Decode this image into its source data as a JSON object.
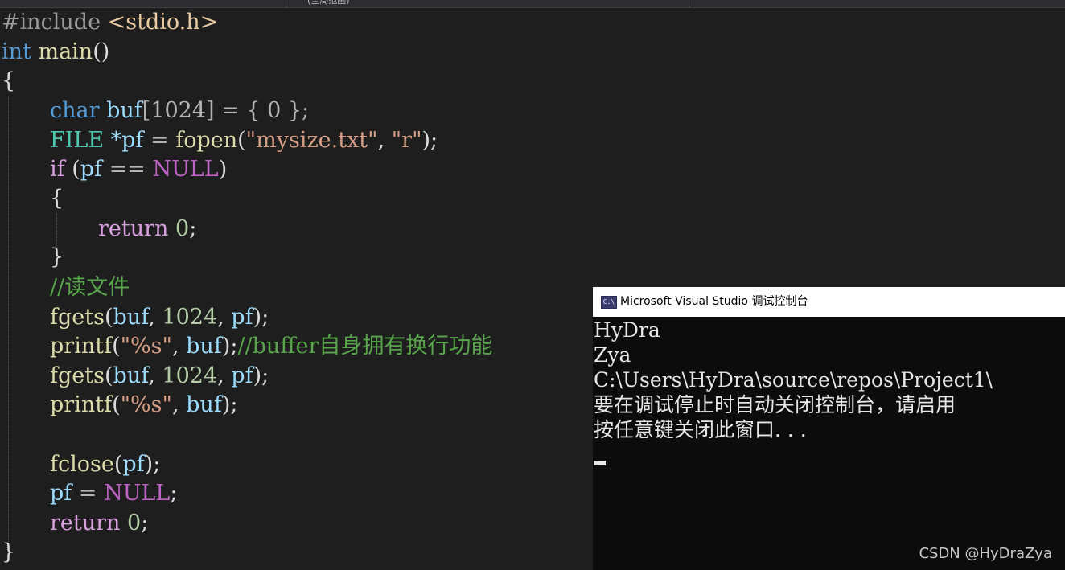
{
  "window": {
    "tab_fragment": "(全局范围)"
  },
  "editor": {
    "colors": {
      "background": "#1e1e1e",
      "keyword": "#569cd6",
      "function": "#dcdcaa",
      "variable": "#9cdcfe",
      "number": "#b5cea8",
      "string": "#d69d85",
      "comment": "#57a64a",
      "type": "#4ec9b0",
      "control": "#d8a0df"
    },
    "code": {
      "include_directive": "#include",
      "include_header": "<stdio.h>",
      "kw_int": "int",
      "fn_main": "main",
      "parens": "()",
      "brace_open": "{",
      "brace_close": "}",
      "kw_char": "char",
      "var_buf": "buf",
      "bracket_1024": "[1024]",
      "eq": " = ",
      "init_zero": "{ 0 };",
      "type_file": "FILE",
      "star_pf": "*pf",
      "fn_fopen": "fopen",
      "str_filename": "\"mysize.txt\"",
      "comma_sp": ", ",
      "str_mode": "\"r\"",
      "close_semi": ");",
      "kw_if": "if",
      "if_open": " (",
      "var_pf": "pf",
      "op_eqeq": " == ",
      "null": "NULL",
      "paren_close": ")",
      "kw_return": "return",
      "num_zero": "0",
      "semi": ";",
      "comment_read": "//读文件",
      "fn_fgets": "fgets",
      "open_paren": "(",
      "num_1024": "1024",
      "fn_printf": "printf",
      "str_fmt": "\"%s\"",
      "comment_buffer": "//buffer自身拥有换行功能",
      "fn_fclose": "fclose",
      "assign": " = "
    }
  },
  "console": {
    "title": "Microsoft Visual Studio 调试控制台",
    "icon_label": "C:\\",
    "lines": [
      "HyDra",
      "Zya",
      "C:\\Users\\HyDra\\source\\repos\\Project1\\",
      "要在调试停止时自动关闭控制台，请启用",
      "按任意键关闭此窗口. . ."
    ],
    "colors": {
      "background": "#0c0c0c",
      "text": "#e6e6e6",
      "titlebar": "#ffffff"
    }
  },
  "watermark": "CSDN @HyDraZya"
}
